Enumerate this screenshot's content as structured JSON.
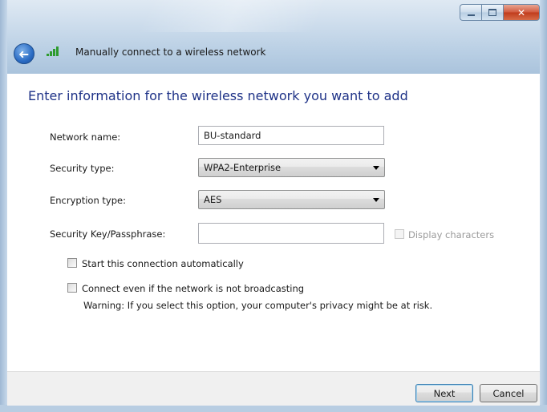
{
  "window": {
    "title_bar_controls": {
      "minimize_icon": "minimize-icon",
      "maximize_icon": "maximize-icon",
      "close_icon": "close-icon",
      "close_glyph": "✕"
    }
  },
  "address": {
    "back_glyph": "➜",
    "text": "Manually connect to a wireless network"
  },
  "form": {
    "heading": "Enter information for the wireless network you want to add",
    "network_name": {
      "label": "Network name:",
      "value": "BU-standard"
    },
    "security_type": {
      "label": "Security type:",
      "value": "WPA2-Enterprise"
    },
    "encryption_type": {
      "label": "Encryption type:",
      "value": "AES"
    },
    "security_key": {
      "label": "Security Key/Passphrase:",
      "value": ""
    },
    "display_characters": {
      "label": "Display characters",
      "checked": false,
      "enabled": false
    },
    "start_automatically": {
      "label": "Start this connection automatically",
      "checked": false
    },
    "connect_not_broadcasting": {
      "label": "Connect even if the network is not broadcasting",
      "checked": false
    },
    "warning": "Warning: If you select this option, your computer's privacy might be at risk."
  },
  "footer": {
    "next_label": "Next",
    "cancel_label": "Cancel"
  },
  "colors": {
    "heading": "#1e3287",
    "signal": "#2e9b2e",
    "close_button": "#c03b1c"
  }
}
